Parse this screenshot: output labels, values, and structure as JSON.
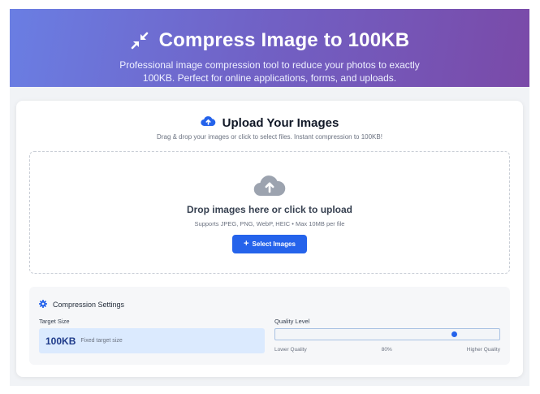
{
  "hero": {
    "title": "Compress Image to 100KB",
    "subtitle_line1": "Professional image compression tool to reduce your photos to exactly",
    "subtitle_line2": "100KB. Perfect for online applications, forms, and uploads.",
    "icon": "compress-arrows-icon"
  },
  "upload": {
    "title": "Upload Your Images",
    "description": "Drag & drop your images or click to select files. Instant compression to 100KB!",
    "icon": "cloud-upload-icon",
    "dropzone": {
      "icon": "cloud-upload-icon",
      "title": "Drop images here or click to upload",
      "subtitle": "Supports JPEG, PNG, WebP, HEIC • Max 10MB per file",
      "button_label": "Select Images"
    }
  },
  "settings": {
    "title": "Compression Settings",
    "icon": "gear-icon",
    "target_size_label": "Target Size",
    "target_size_value": "100KB",
    "target_size_note": "Fixed target size",
    "quality_label": "Quality Level",
    "quality_value": 80,
    "quality_min_label": "Lower Quality",
    "quality_current_label": "80%",
    "quality_max_label": "Higher Quality"
  },
  "colors": {
    "accent": "#2563eb",
    "hero_gradient_start": "#6a7ee3",
    "hero_gradient_end": "#7a4aa8"
  }
}
